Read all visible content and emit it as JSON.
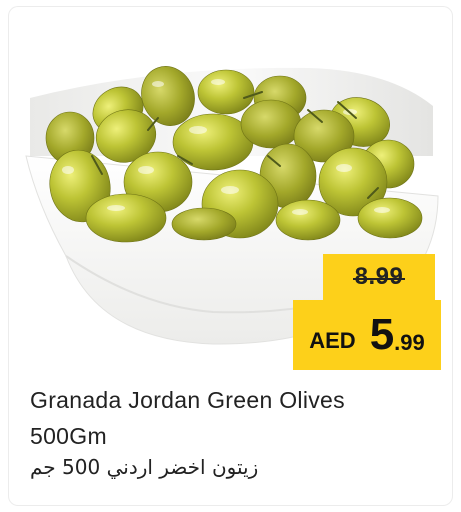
{
  "product": {
    "name_line1": "Granada Jordan Green Olives",
    "name_line2": "500Gm",
    "name_arabic": "زيتون اخضر اردني 500 جم",
    "image": "green olives in white square bowl"
  },
  "price": {
    "old": "8.99",
    "currency": "AED",
    "new_int": "5",
    "new_dec": ".99"
  },
  "colors": {
    "tag_yellow": "#fdd01a",
    "olive_green": "#b5bd2c",
    "bowl": "#f7f7f5"
  }
}
